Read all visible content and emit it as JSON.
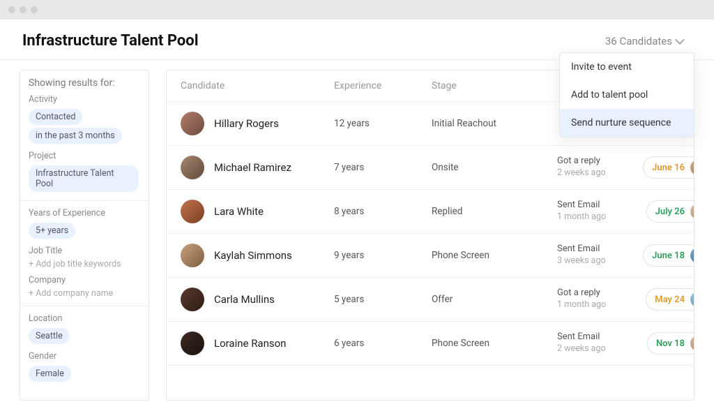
{
  "header": {
    "title": "Infrastructure Talent Pool",
    "count_label": "36 Candidates"
  },
  "sidebar": {
    "showing_label": "Showing results for:",
    "activity_label": "Activity",
    "activity_pill1": "Contacted",
    "activity_pill2": "in the past 3 months",
    "project_label": "Project",
    "project_pill": "Infrastructure Talent Pool",
    "yoe_label": "Years of Experience",
    "yoe_pill": "5+ years",
    "jobtitle_label": "Job Title",
    "jobtitle_placeholder": "+ Add job title keywords",
    "company_label": "Company",
    "company_placeholder": "+ Add company name",
    "location_label": "Location",
    "location_pill": "Seattle",
    "gender_label": "Gender",
    "gender_pill": "Female"
  },
  "columns": {
    "candidate": "Candidate",
    "experience": "Experience",
    "stage": "Stage"
  },
  "dropdown": {
    "item1": "Invite to event",
    "item2": "Add to talent pool",
    "item3": "Send nurture sequence"
  },
  "rows": [
    {
      "name": "Hillary Rogers",
      "experience": "12 years",
      "stage": "Initial Reachout",
      "status": "",
      "time": "",
      "date": "",
      "date_color": "",
      "c1": "#b57e6a",
      "c2": "#6a4a3d",
      "d1": "#c49b7d",
      "d2": "#7a5a43"
    },
    {
      "name": "Michael Ramirez",
      "experience": "7 years",
      "stage": "Onsite",
      "status": "Got a reply",
      "time": "2 weeks ago",
      "date": "June 16",
      "date_color": "orange",
      "c1": "#a8866e",
      "c2": "#5e4a3a",
      "d1": "#d3b18c",
      "d2": "#8a6b4f"
    },
    {
      "name": "Lara White",
      "experience": "8 years",
      "stage": "Replied",
      "status": "Sent Email",
      "time": "1 month ago",
      "date": "July 26",
      "date_color": "green",
      "c1": "#c2734a",
      "c2": "#7a3f26",
      "d1": "#e0c6a8",
      "d2": "#9c7a5a"
    },
    {
      "name": "Kaylah Simmons",
      "experience": "9 years",
      "stage": "Phone Screen",
      "status": "Sent Email",
      "time": "3 weeks ago",
      "date": "June 18",
      "date_color": "green",
      "c1": "#c9a07a",
      "c2": "#7d5d41",
      "d1": "#7fa8c9",
      "d2": "#3f6a8c"
    },
    {
      "name": "Carla Mullins",
      "experience": "5 years",
      "stage": "Offer",
      "status": "Got a reply",
      "time": "1 month ago",
      "date": "May 24",
      "date_color": "orange",
      "c1": "#5a3a2d",
      "c2": "#2d1c15",
      "d1": "#a0c4d8",
      "d2": "#5a8aa3"
    },
    {
      "name": "Loraine Ranson",
      "experience": "6 years",
      "stage": "Phone Screen",
      "status": "Sent Email",
      "time": "2 weeks ago",
      "date": "Nov 18",
      "date_color": "green",
      "c1": "#3d2a20",
      "c2": "#1a1210",
      "d1": "#d8b8a0",
      "d2": "#a08060"
    }
  ]
}
